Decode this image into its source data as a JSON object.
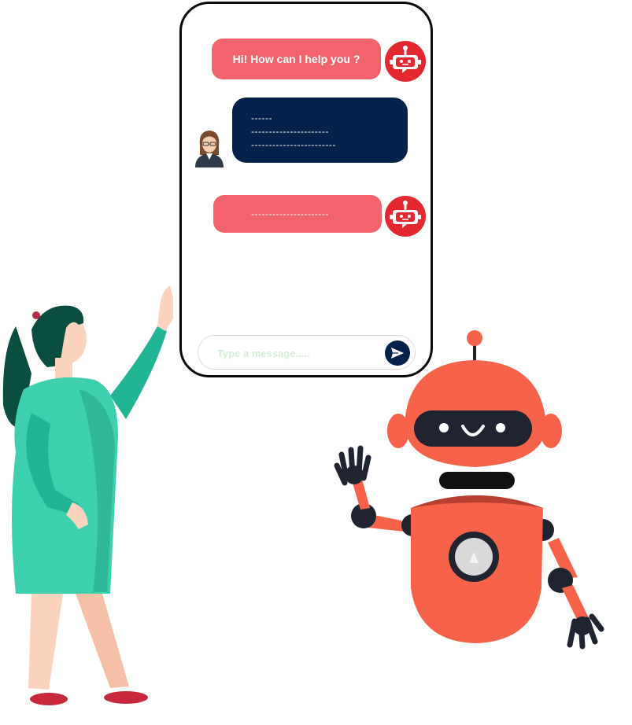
{
  "chat": {
    "messages": [
      {
        "sender": "bot",
        "text": "Hi!  How can I help you ?"
      },
      {
        "sender": "user",
        "lines": [
          "------",
          "----------------------",
          "------------------------"
        ]
      },
      {
        "sender": "bot",
        "text": "----------------------"
      }
    ]
  },
  "input": {
    "placeholder": "Type a message....."
  },
  "icons": {
    "bot_avatar": "robot-icon",
    "user_avatar": "woman-avatar-icon",
    "send": "paper-plane-icon"
  },
  "colors": {
    "bot_bubble": "#f2646b",
    "user_bubble": "#04214a",
    "bot_avatar_bg": "#e3292f",
    "woman_dress": "#3ecfae",
    "robot_body": "#f7634a"
  }
}
